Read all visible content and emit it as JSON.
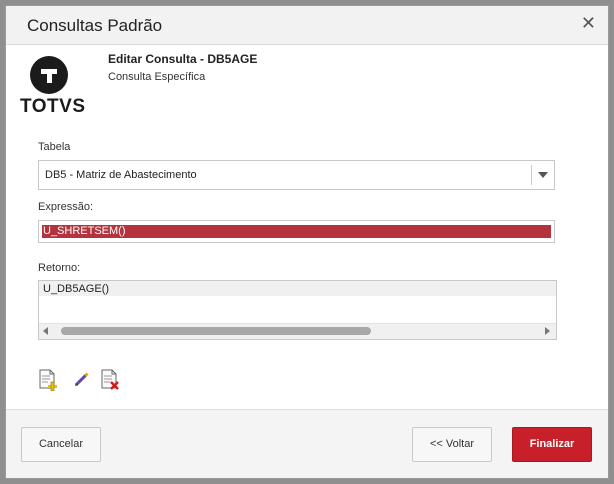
{
  "dialog": {
    "title": "Consultas Padrão",
    "close_glyph": "✕"
  },
  "logo": {
    "text": "TOTVS"
  },
  "header": {
    "title": "Editar Consulta - DB5AGE",
    "subtitle": "Consulta Específica"
  },
  "form": {
    "tabela_label": "Tabela",
    "tabela_value": "DB5 - Matriz de Abastecimento",
    "expressao_label": "Expressão:",
    "expressao_value": "U_SHRETSEM()",
    "retorno_label": "Retorno:",
    "retorno_value": "U_DB5AGE()"
  },
  "toolbar": {
    "icons": [
      "add-document-icon",
      "edit-pencil-icon",
      "delete-document-icon"
    ]
  },
  "footer": {
    "cancel_label": "Cancelar",
    "back_label": "<< Voltar",
    "finish_label": "Finalizar"
  },
  "colors": {
    "primary": "#c8202b",
    "selection": "#b5333c"
  }
}
